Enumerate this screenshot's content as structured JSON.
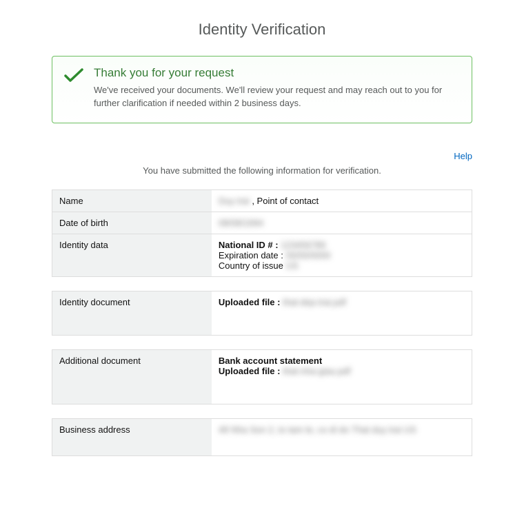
{
  "page_title": "Identity Verification",
  "success": {
    "title": "Thank you for your request",
    "text": "We've received your documents. We'll review your request and may reach out to you for further clarification if needed within 2 business days."
  },
  "help_label": "Help",
  "intro": "You have submitted the following information for verification.",
  "name_label": "Name",
  "name_value_blurred": "Duy trai",
  "name_suffix": " , Point of contact",
  "dob_label": "Date of birth",
  "dob_value_blurred": "08/08/1994",
  "identity_label": "Identity data",
  "identity_national_id_label": "National ID # : ",
  "identity_national_id_blurred": "123456789",
  "identity_expiration_label": "Expiration date : ",
  "identity_expiration_blurred": "00/00/0000",
  "identity_country_label": "Country of issue  ",
  "identity_country_blurred": "US",
  "identity_doc_label": "Identity document",
  "uploaded_file_label": "Uploaded file :  ",
  "identity_doc_file": "that-dep-trai.pdf",
  "additional_doc_label": "Additional document",
  "additional_doc_type": "Bank account statement",
  "additional_doc_file": "that-nha-giau.pdf",
  "biz_addr_label": "Business address",
  "biz_addr_line1_blurred": "48 Nha Son 2, to tam le, co di do",
  "biz_addr_line2_blurred": "That duy trai",
  "biz_addr_line3_blurred": "US"
}
